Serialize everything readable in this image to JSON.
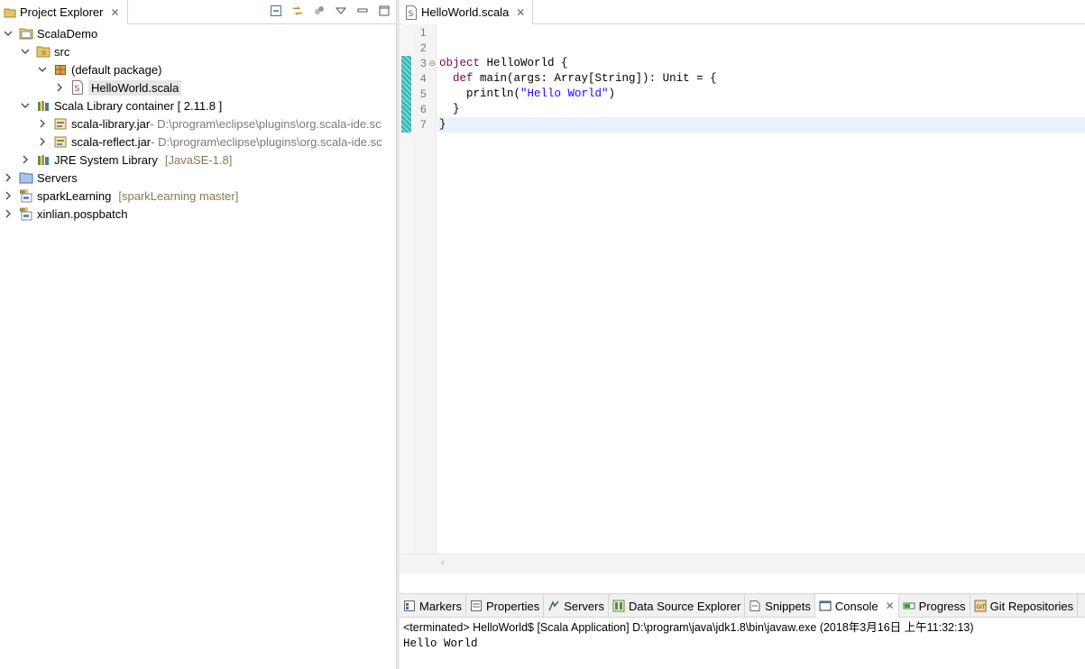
{
  "explorer": {
    "tab_label": "Project Explorer",
    "tree": [
      {
        "label": "ScalaDemo",
        "indent": 0,
        "twisty": "expanded",
        "icon": "project-folder-icon"
      },
      {
        "label": "src",
        "indent": 1,
        "twisty": "expanded",
        "icon": "source-folder-icon"
      },
      {
        "label": "(default package)",
        "indent": 2,
        "twisty": "expanded",
        "icon": "package-icon"
      },
      {
        "label": "HelloWorld.scala",
        "indent": 3,
        "twisty": "collapsed",
        "icon": "scala-file-icon",
        "selected": true
      },
      {
        "label": "Scala Library container [ 2.11.8 ]",
        "indent": 1,
        "twisty": "expanded",
        "icon": "library-icon"
      },
      {
        "label": "scala-library.jar",
        "indent": 2,
        "twisty": "collapsed",
        "icon": "jar-icon",
        "path": " - D:\\program\\eclipse\\plugins\\org.scala-ide.sc"
      },
      {
        "label": "scala-reflect.jar",
        "indent": 2,
        "twisty": "collapsed",
        "icon": "jar-icon",
        "path": " - D:\\program\\eclipse\\plugins\\org.scala-ide.sc"
      },
      {
        "label": "JRE System Library",
        "indent": 1,
        "twisty": "collapsed",
        "icon": "library-icon",
        "decoration": "[JavaSE-1.8]"
      },
      {
        "label": "Servers",
        "indent": 0,
        "twisty": "collapsed",
        "icon": "folder-icon"
      },
      {
        "label": "sparkLearning",
        "indent": 0,
        "twisty": "collapsed",
        "icon": "git-project-icon",
        "decoration": "[sparkLearning master]"
      },
      {
        "label": "xinlian.pospbatch",
        "indent": 0,
        "twisty": "collapsed",
        "icon": "git-project-icon"
      }
    ]
  },
  "editor": {
    "tab_label": "HelloWorld.scala",
    "lines": [
      {
        "n": "1",
        "tokens": []
      },
      {
        "n": "2",
        "tokens": []
      },
      {
        "n": "3",
        "tokens": [
          {
            "t": "object",
            "c": "kw"
          },
          {
            "t": " HelloWorld {",
            "c": ""
          }
        ],
        "fold": true,
        "mark": true
      },
      {
        "n": "4",
        "tokens": [
          {
            "t": "  ",
            "c": ""
          },
          {
            "t": "def",
            "c": "kw"
          },
          {
            "t": " main(args: Array[String]): Unit = {",
            "c": ""
          }
        ],
        "mark": true
      },
      {
        "n": "5",
        "tokens": [
          {
            "t": "    println(",
            "c": ""
          },
          {
            "t": "\"Hello World\"",
            "c": "str"
          },
          {
            "t": ")",
            "c": ""
          }
        ],
        "mark": true
      },
      {
        "n": "6",
        "tokens": [
          {
            "t": "  }",
            "c": ""
          }
        ],
        "mark": true
      },
      {
        "n": "7",
        "tokens": [
          {
            "t": "}",
            "c": ""
          }
        ],
        "mark": true,
        "current": true
      }
    ]
  },
  "bottom_tabs": [
    {
      "label": "Markers",
      "icon": "markers-icon"
    },
    {
      "label": "Properties",
      "icon": "properties-icon"
    },
    {
      "label": "Servers",
      "icon": "servers-icon"
    },
    {
      "label": "Data Source Explorer",
      "icon": "data-source-icon"
    },
    {
      "label": "Snippets",
      "icon": "snippets-icon"
    },
    {
      "label": "Console",
      "icon": "console-icon",
      "active": true
    },
    {
      "label": "Progress",
      "icon": "progress-icon"
    },
    {
      "label": "Git Repositories",
      "icon": "git-repo-icon"
    }
  ],
  "console": {
    "status": "<terminated> HelloWorld$ [Scala Application] D:\\program\\java\\jdk1.8\\bin\\javaw.exe (2018年3月16日 上午11:32:13)",
    "output": "Hello World"
  }
}
